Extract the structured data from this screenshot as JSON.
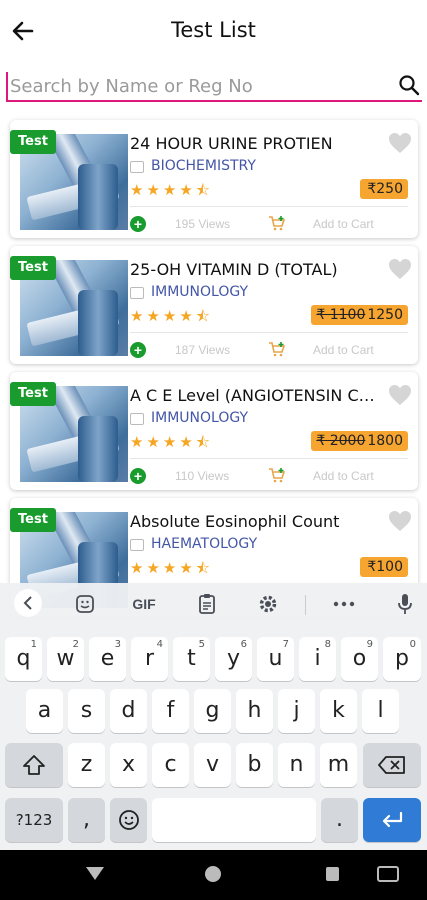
{
  "header": {
    "title": "Test List",
    "back_icon": "arrow-left-icon"
  },
  "search": {
    "placeholder": "Search by Name or Reg No",
    "value": "",
    "icon": "search-icon"
  },
  "items": [
    {
      "badge": "Test",
      "name": "24 HOUR URINE PROTIEN",
      "category": "BIOCHEMISTRY",
      "rating": 4.5,
      "stars": "★★★★⯪",
      "price_old": "",
      "price": "₹250",
      "views": "195 Views",
      "cart": "Add to Cart"
    },
    {
      "badge": "Test",
      "name": "25-OH VITAMIN D (TOTAL)",
      "category": "IMMUNOLOGY",
      "rating": 4.5,
      "stars": "★★★★⯪",
      "price_old": "₹ 1100",
      "price": "1250",
      "views": "187 Views",
      "cart": "Add to Cart"
    },
    {
      "badge": "Test",
      "name": "A C E Level (ANGIOTENSIN CO...",
      "category": "IMMUNOLOGY",
      "rating": 4.5,
      "stars": "★★★★⯪",
      "price_old": "₹ 2000",
      "price": "1800",
      "views": "110 Views",
      "cart": "Add to Cart"
    },
    {
      "badge": "Test",
      "name": "Absolute Eosinophil Count",
      "category": "HAEMATOLOGY",
      "rating": 4.5,
      "stars": "★★★★⯪",
      "price_old": "",
      "price": "₹100",
      "views": "",
      "cart": ""
    }
  ],
  "keyboard": {
    "toolbar": {
      "gif": "GIF"
    },
    "row1": [
      {
        "k": "q",
        "h": "1"
      },
      {
        "k": "w",
        "h": "2"
      },
      {
        "k": "e",
        "h": "3"
      },
      {
        "k": "r",
        "h": "4"
      },
      {
        "k": "t",
        "h": "5"
      },
      {
        "k": "y",
        "h": "6"
      },
      {
        "k": "u",
        "h": "7"
      },
      {
        "k": "i",
        "h": "8"
      },
      {
        "k": "o",
        "h": "9"
      },
      {
        "k": "p",
        "h": "0"
      }
    ],
    "row2": [
      "a",
      "s",
      "d",
      "f",
      "g",
      "h",
      "j",
      "k",
      "l"
    ],
    "row3": [
      "z",
      "x",
      "c",
      "v",
      "b",
      "n",
      "m"
    ],
    "symbols": "?123",
    "comma": ",",
    "period": ".",
    "emoji_icon": "smiley-icon",
    "enter_icon": "enter-icon"
  },
  "colors": {
    "accent": "#e0177b",
    "badge": "#1a9b2e",
    "price": "#f7a531",
    "star": "#f5a623",
    "category": "#4456a8"
  }
}
